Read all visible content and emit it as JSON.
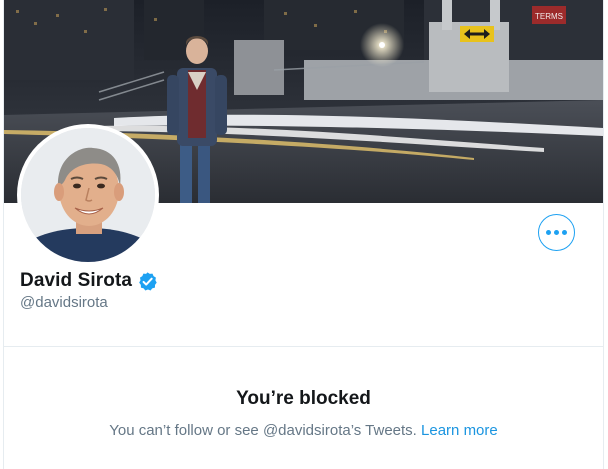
{
  "profile": {
    "display_name": "David Sirota",
    "handle": "@davidsirota",
    "verified": true
  },
  "icons": {
    "verified": "verified-badge-icon",
    "more": "more-options-icon"
  },
  "banner": {
    "sign_text": "TERMS"
  },
  "blocked": {
    "title": "You’re blocked",
    "message": "You can’t follow or see @davidsirota’s Tweets.",
    "link_label": "Learn more"
  },
  "colors": {
    "accent": "#1da1f2",
    "link": "#1b95e0",
    "secondary_text": "#657786",
    "primary_text": "#14171a",
    "border": "#e6ecf0"
  }
}
